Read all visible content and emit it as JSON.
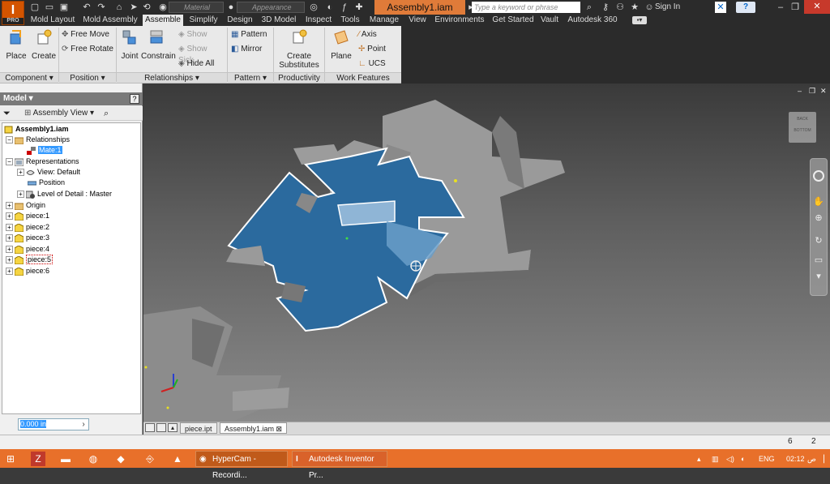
{
  "window": {
    "title": "Assembly1.iam",
    "search_placeholder": "Type a keyword or phrase",
    "sign_in": "Sign In",
    "help": "?",
    "logo": "I",
    "logo_sub": "PRO"
  },
  "quick_access": {
    "material_placeholder": "Material",
    "appearance_placeholder": "Appearance"
  },
  "menu_tabs": [
    "Mold Layout",
    "Mold Assembly",
    "Assemble",
    "Simplify",
    "Design",
    "3D Model",
    "Inspect",
    "Tools",
    "Manage",
    "View",
    "Environments",
    "Get Started",
    "Vault",
    "Autodesk 360"
  ],
  "active_tab": "Assemble",
  "ribbon": {
    "place": "Place",
    "create": "Create",
    "free_move": "Free Move",
    "free_rotate": "Free Rotate",
    "joint": "Joint",
    "constrain": "Constrain",
    "show": "Show",
    "show_sick": "Show Sick",
    "hide_all": "Hide All",
    "pattern": "Pattern",
    "mirror": "Mirror",
    "create_substitutes_1": "Create",
    "create_substitutes_2": "Substitutes",
    "plane": "Plane",
    "axis": "Axis",
    "point": "Point",
    "ucs": "UCS",
    "panels": {
      "component": "Component",
      "position": "Position",
      "relationships": "Relationships",
      "pattern": "Pattern",
      "productivity": "Productivity",
      "work_features": "Work Features"
    }
  },
  "browser": {
    "title": "Model",
    "view": "Assembly View",
    "tree": {
      "root": "Assembly1.iam",
      "relationships": "Relationships",
      "mate": "Mate:1",
      "representations": "Representations",
      "view_default": "View: Default",
      "position": "Position",
      "level_of_detail": "Level of Detail : Master",
      "origin": "Origin",
      "pieces": [
        "piece:1",
        "piece:2",
        "piece:3",
        "piece:4",
        "piece:5",
        "piece:6"
      ]
    },
    "value": "0.000 in"
  },
  "document_tabs": [
    "piece.ipt",
    "Assembly1.iam"
  ],
  "status": {
    "count_a": "6",
    "count_b": "2"
  },
  "taskbar": {
    "hypercam": "HyperCam - Recordi...",
    "inventor": "Autodesk Inventor Pr...",
    "lang": "ENG",
    "time": "02:12",
    "ampm": "ص"
  },
  "viewcube": {
    "back": "BACK",
    "bottom": "BOTTOM"
  },
  "colors": {
    "accent": "#e07b39",
    "selection": "#2b6a9e",
    "piece": "#a8a8a8"
  }
}
